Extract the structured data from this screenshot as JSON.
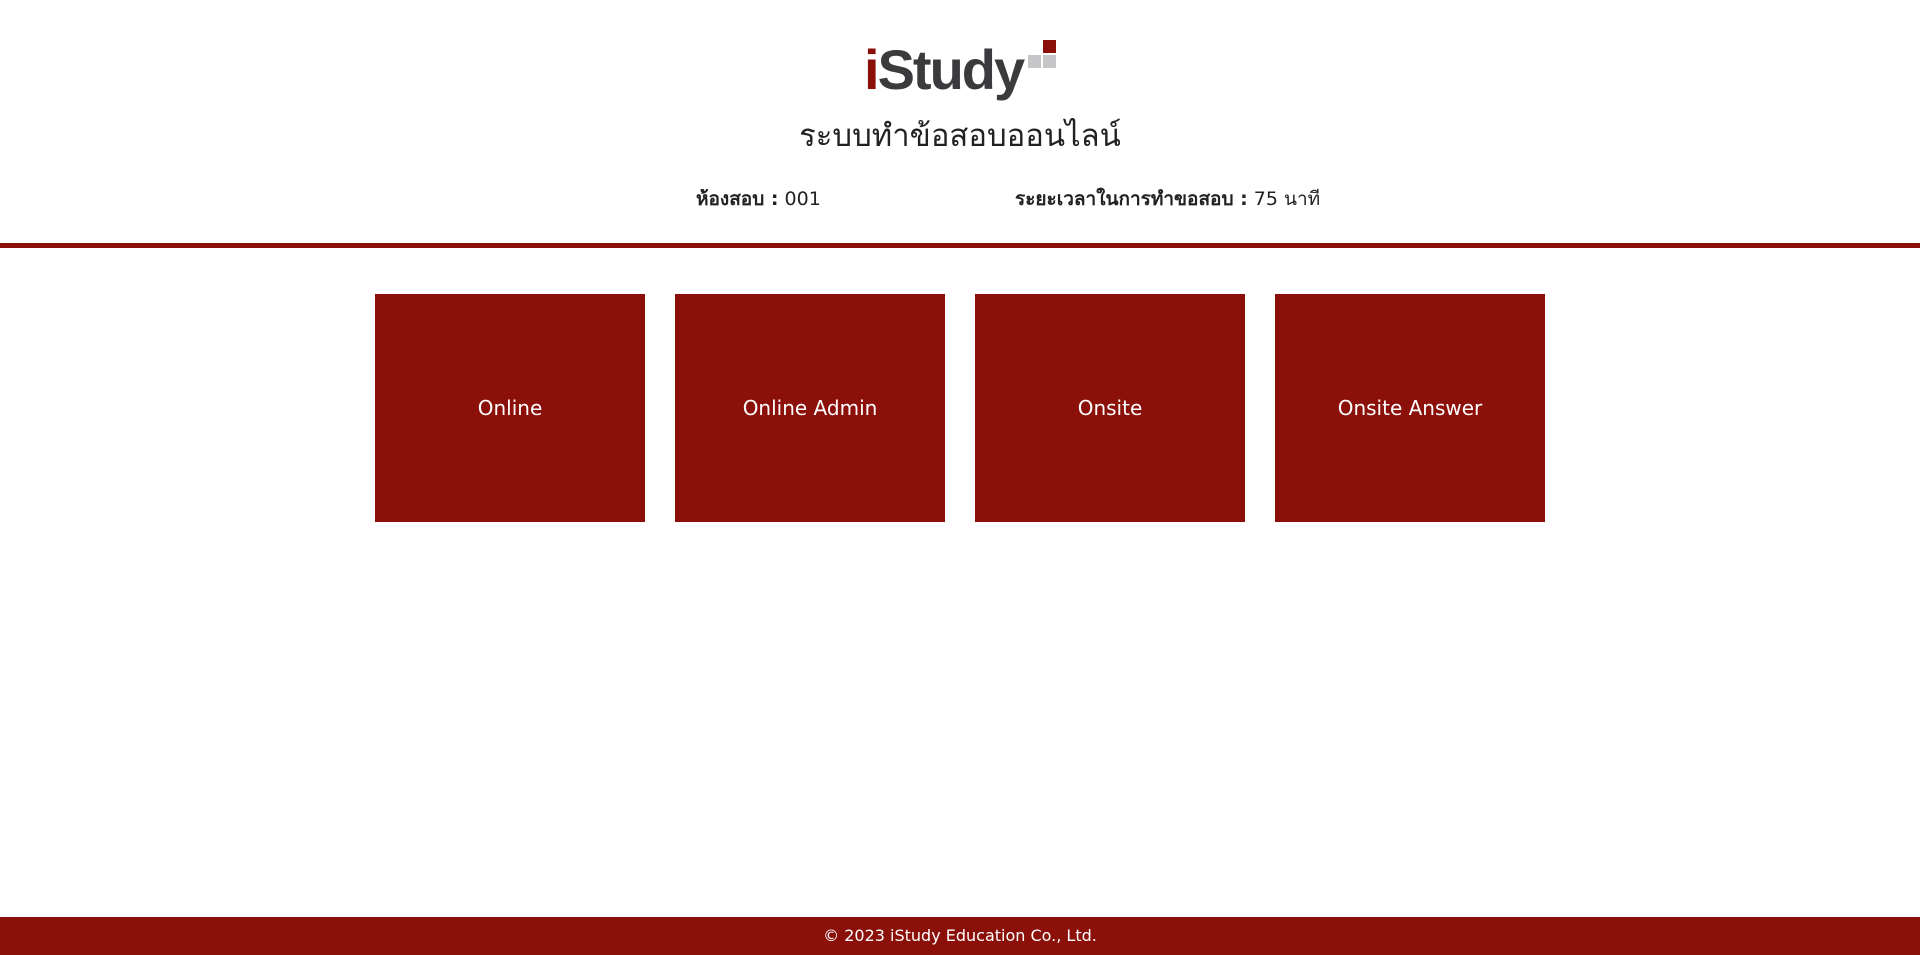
{
  "brand": {
    "logo_prefix": "i",
    "logo_rest": "Study",
    "accent_color": "#8b1009",
    "logo_gray": "#3b3b3d"
  },
  "header": {
    "subtitle": "ระบบทำข้อสอบออนไลน์",
    "room_label": "ห้องสอบ :",
    "room_value": "001",
    "duration_label": "ระยะเวลาในการทำขอสอบ :",
    "duration_value": "75 นาที"
  },
  "menu": {
    "tiles": [
      {
        "label": "Online"
      },
      {
        "label": "Online Admin"
      },
      {
        "label": "Onsite"
      },
      {
        "label": "Onsite Answer"
      }
    ]
  },
  "footer": {
    "copyright": "© 2023 iStudy Education Co., Ltd."
  }
}
